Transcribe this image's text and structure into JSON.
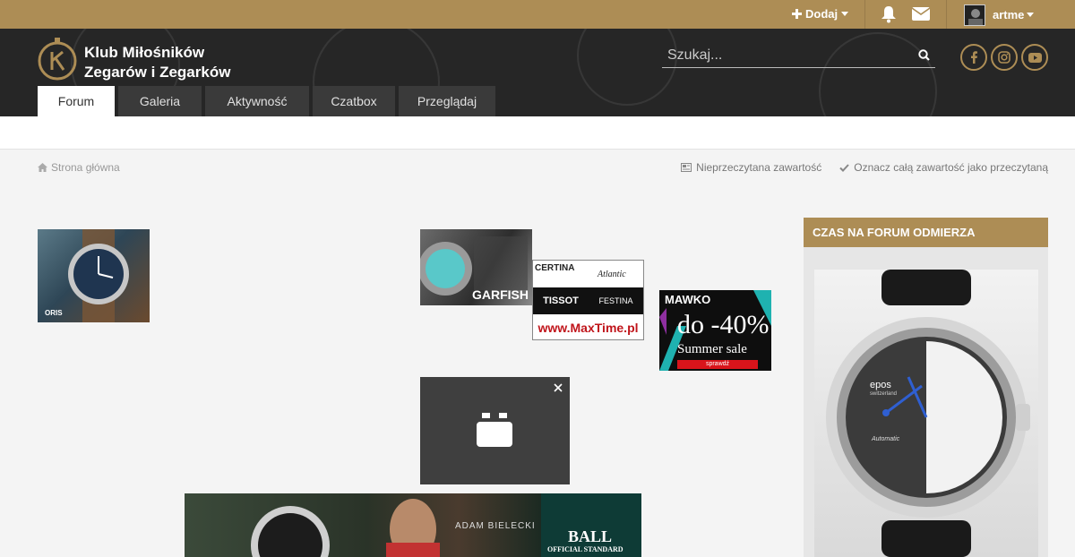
{
  "topbar": {
    "add_label": "Dodaj",
    "username": "artme",
    "icons": [
      "plus-icon",
      "bell-icon",
      "mail-icon"
    ]
  },
  "header": {
    "site_name_line1": "Klub Miłośników",
    "site_name_line2": "Zegarów i Zegarków",
    "search_placeholder": "Szukaj...",
    "tabs": [
      {
        "label": "Forum"
      },
      {
        "label": "Galeria"
      },
      {
        "label": "Aktywność"
      },
      {
        "label": "Czatbox"
      },
      {
        "label": "Przeglądaj"
      }
    ],
    "social": [
      "facebook-icon",
      "instagram-icon",
      "youtube-icon"
    ]
  },
  "breadcrumb": {
    "home_label": "Strona główna"
  },
  "actions": {
    "unread_label": "Nieprzeczytana zawartość",
    "mark_read_label": "Oznacz całą zawartość jako przeczytaną"
  },
  "ads": {
    "oris_text": "ORIS",
    "garfish_text": "GARFISH",
    "maxtime_brands": [
      "CERTINA",
      "Atlantic",
      "TISSOT",
      "FESTINA"
    ],
    "maxtime_url": "www.MaxTime.pl",
    "mawko_brand": "MAWKO",
    "mawko_discount": "do -40%",
    "mawko_sale": "Summer sale",
    "mawko_cta": "sprawdź",
    "ball_person": "ADAM BIELECKI",
    "ball_brand": "BALL",
    "ball_tagline": "OFFICIAL STANDARD"
  },
  "sidebar": {
    "title": "CZAS NA FORUM ODMIERZA",
    "watch_brand": "epos",
    "watch_sub": "switzerland",
    "watch_label": "Automatic"
  },
  "colors": {
    "gold": "#ad8d55",
    "header_dark": "#262626"
  }
}
